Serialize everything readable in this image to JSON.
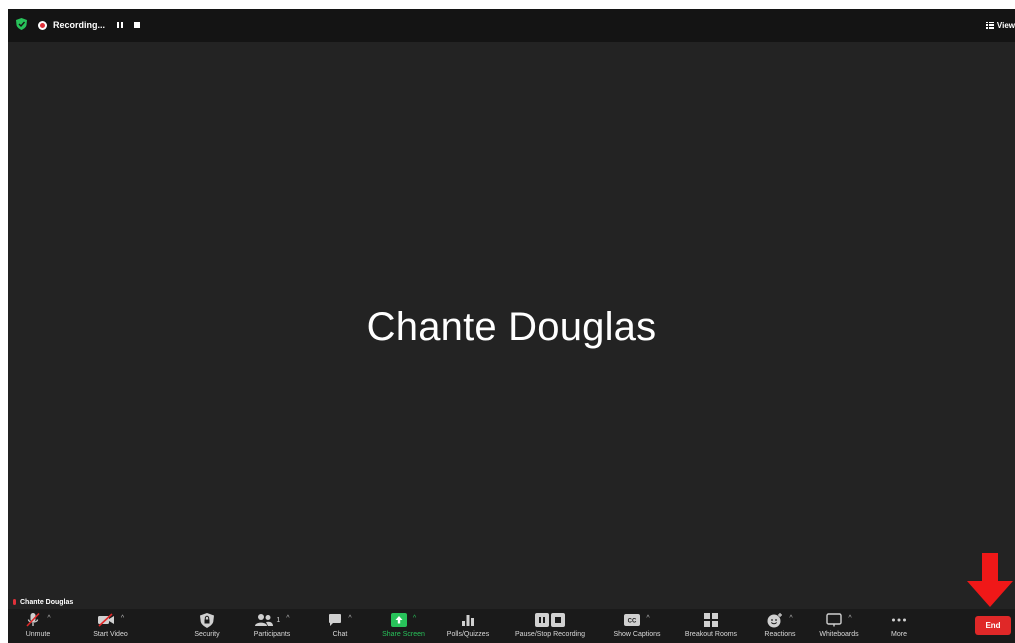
{
  "topbar": {
    "recording_label": "Recording...",
    "view_label": "View"
  },
  "main": {
    "participant_name": "Chante Douglas"
  },
  "self_view": {
    "name": "Chante Douglas"
  },
  "toolbar": {
    "unmute": "Unmute",
    "start_video": "Start Video",
    "security": "Security",
    "participants": "Participants",
    "participants_count": "1",
    "chat": "Chat",
    "share_screen": "Share Screen",
    "polls": "Polls/Quizzes",
    "pause_stop_recording": "Pause/Stop Recording",
    "show_captions": "Show Captions",
    "breakout_rooms": "Breakout Rooms",
    "reactions": "Reactions",
    "whiteboards": "Whiteboards",
    "more": "More",
    "end": "End"
  },
  "colors": {
    "end_red": "#e02828",
    "share_green": "#28c25a",
    "background": "#232323",
    "toolbar": "#1a1a1a"
  }
}
